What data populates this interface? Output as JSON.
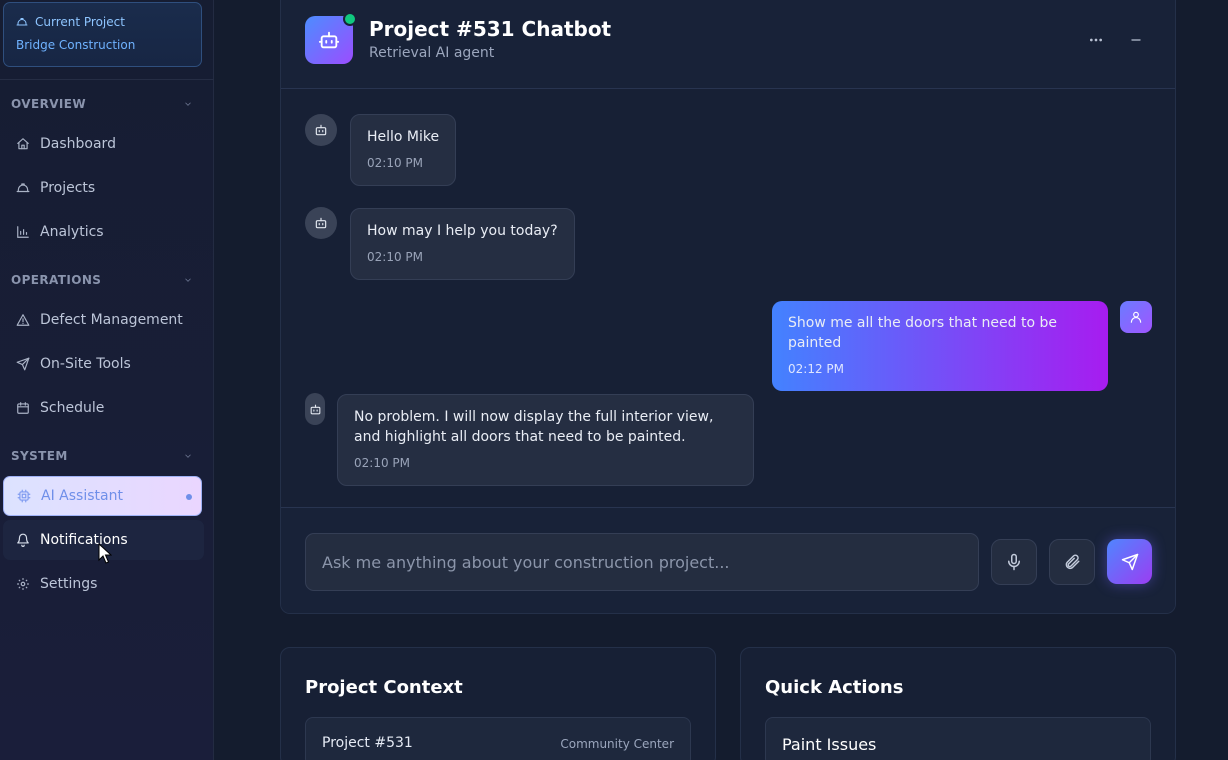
{
  "sidebar": {
    "current_project": {
      "label": "Current Project",
      "name": "Bridge Construction"
    },
    "sections": [
      {
        "title": "OVERVIEW",
        "items": [
          "Dashboard",
          "Projects",
          "Analytics"
        ]
      },
      {
        "title": "OPERATIONS",
        "items": [
          "Defect Management",
          "On-Site Tools",
          "Schedule"
        ]
      },
      {
        "title": "SYSTEM",
        "items": [
          "AI Assistant",
          "Notifications",
          "Settings"
        ]
      }
    ],
    "active_item": "AI Assistant"
  },
  "chat": {
    "title": "Project #531 Chatbot",
    "subtitle": "Retrieval AI agent",
    "messages": [
      {
        "sender": "bot",
        "text": "Hello Mike",
        "time": "02:10 PM"
      },
      {
        "sender": "bot",
        "text": "How may I help you today?",
        "time": "02:10 PM"
      },
      {
        "sender": "user",
        "text": "Show me all the doors that need to be painted",
        "time": "02:12 PM"
      },
      {
        "sender": "bot",
        "text": "No problem. I will now display the full interior view, and highlight all doors that need to be painted.",
        "time": "02:10 PM"
      }
    ],
    "input_placeholder": "Ask me anything about your construction project..."
  },
  "project_context": {
    "title": "Project Context",
    "project_name": "Project #531",
    "project_type": "Community Center"
  },
  "quick_actions": {
    "title": "Quick Actions",
    "items": [
      "Paint Issues"
    ]
  },
  "colors": {
    "accent_gradient_start": "#4382ff",
    "accent_gradient_end": "#a71cf0",
    "online_status": "#10c97f"
  }
}
